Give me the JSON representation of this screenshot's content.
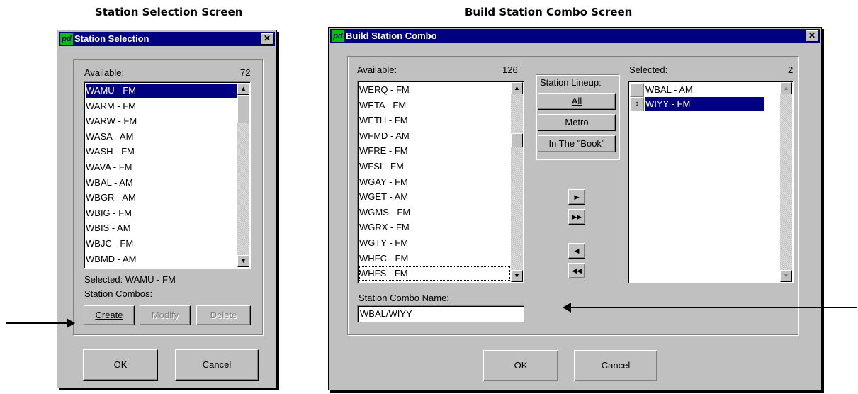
{
  "captions": {
    "left": "Station Selection Screen",
    "right": "Build Station Combo Screen"
  },
  "station_selection": {
    "title": "Station Selection",
    "close_label": "✕",
    "available_label": "Available:",
    "available_count": "72",
    "stations": [
      "WAMU - FM",
      "WARM - FM",
      "WARW - FM",
      "WASA - AM",
      "WASH - FM",
      "WAVA - FM",
      "WBAL - AM",
      "WBGR - AM",
      "WBIG - FM",
      "WBIS - AM",
      "WBJC - FM",
      "WBMD - AM"
    ],
    "selected_index": 0,
    "selected_text": "Selected: WAMU - FM",
    "combos_label": "Station Combos:",
    "create_label": "Create",
    "modify_label": "Modify",
    "delete_label": "Delete",
    "ok_label": "OK",
    "cancel_label": "Cancel"
  },
  "build_combo": {
    "title": "Build Station Combo",
    "close_label": "✕",
    "available_label": "Available:",
    "available_count": "126",
    "stations": [
      "WERQ - FM",
      "WETA - FM",
      "WETH - FM",
      "WFMD - AM",
      "WFRE - FM",
      "WFSI - FM",
      "WGAY - FM",
      "WGET - AM",
      "WGMS - FM",
      "WGRX - FM",
      "WGTY - FM",
      "WHFC - FM",
      "WHFS - FM"
    ],
    "lineup_label": "Station Lineup:",
    "all_label": "All",
    "metro_label": "Metro",
    "book_label": "In The \"Book\"",
    "selected_label": "Selected:",
    "selected_count": "2",
    "selected_stations": [
      "WBAL - AM",
      "WIYY - FM"
    ],
    "combo_name_label": "Station Combo Name:",
    "combo_name_value": "WBAL/WIYY",
    "ok_label": "OK",
    "cancel_label": "Cancel"
  }
}
